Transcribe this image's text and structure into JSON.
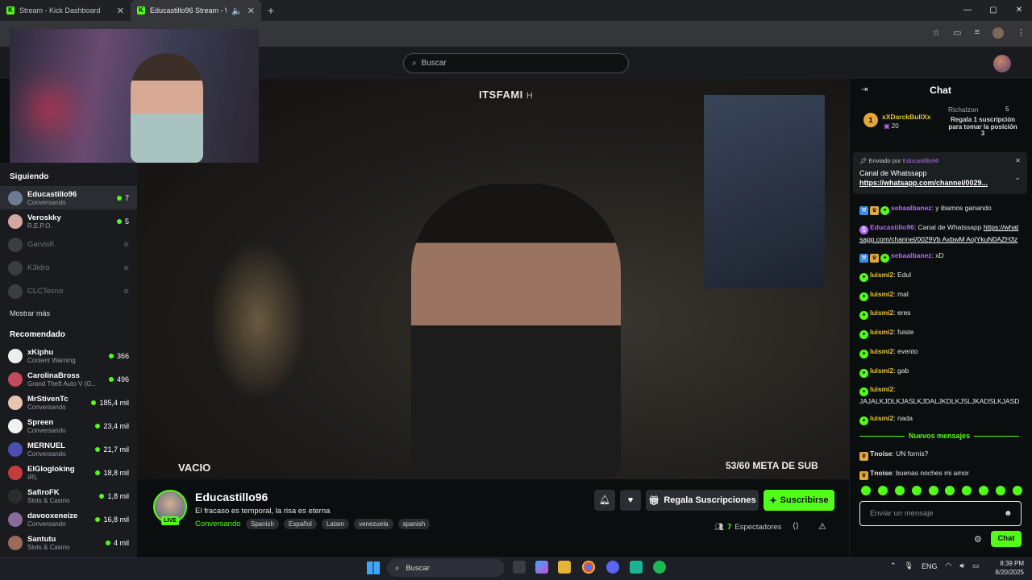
{
  "browser": {
    "tabs": [
      {
        "title": "Stream - Kick Dashboard"
      },
      {
        "title": "Educastillo96 Stream - Wat"
      }
    ],
    "new_tab": "+",
    "controls": {
      "minimize": "—",
      "maximize": "▢",
      "close": "✕"
    }
  },
  "header": {
    "search_placeholder": "Buscar"
  },
  "sidebar": {
    "following_title": "Siguiendo",
    "following": [
      {
        "name": "Educastillo96",
        "category": "Conversando",
        "viewers": "7",
        "avatar_color": "#6d7b95",
        "live": true
      },
      {
        "name": "Veroskky",
        "category": "R.E.P.O.",
        "viewers": "5",
        "avatar_color": "#d4a7a0",
        "live": true
      },
      {
        "name": "GarvisK",
        "category": "",
        "viewers": "",
        "live": false
      },
      {
        "name": "K3idro",
        "category": "",
        "viewers": "",
        "live": false
      },
      {
        "name": "CLCTecno",
        "category": "",
        "viewers": "",
        "live": false
      }
    ],
    "show_more": "Mostrar más",
    "recommended_title": "Recomendado",
    "recommended": [
      {
        "name": "xKiphu",
        "category": "Content Warning",
        "viewers": "366",
        "avatar_color": "#eeeeee"
      },
      {
        "name": "CarolinaBross",
        "category": "Grand Theft Auto V (G...",
        "viewers": "496",
        "avatar_color": "#c24a5a"
      },
      {
        "name": "MrStivenTc",
        "category": "Conversando",
        "viewers": "185,4 mil",
        "avatar_color": "#e8c4b0"
      },
      {
        "name": "Spreen",
        "category": "Conversando",
        "viewers": "23,4 mil",
        "avatar_color": "#f2f2f2"
      },
      {
        "name": "MERNUEL",
        "category": "Conversando",
        "viewers": "21,7 mil",
        "avatar_color": "#4b4fb0"
      },
      {
        "name": "ElGlogloking",
        "category": "IRL",
        "viewers": "18,8 mil",
        "avatar_color": "#c43c3c"
      },
      {
        "name": "SafiroFK",
        "category": "Slots & Casino",
        "viewers": "1,8 mil",
        "avatar_color": "#2c2c2c"
      },
      {
        "name": "davooxeneize",
        "category": "Conversando",
        "viewers": "16,8 mil",
        "avatar_color": "#8a6a9a"
      },
      {
        "name": "Santutu",
        "category": "Slots & Casino",
        "viewers": "4 mil",
        "avatar_color": "#9a6a5a"
      }
    ]
  },
  "video": {
    "overlay_title": "ITSFAMI",
    "overlay_title_suffix": "H",
    "overlay_left": "VACIO",
    "overlay_right": "53/60 META DE SUB"
  },
  "stream": {
    "channel": "Educastillo96",
    "live_badge": "LIVE",
    "title": "El fracaso es temporal, la risa es eterna",
    "category": "Conversando",
    "tags": [
      "Spanish",
      "Español",
      "Latam",
      "venezuela",
      "spanish"
    ],
    "gift_label": "Regala Suscripciones",
    "subscribe_label": "Suscribirse",
    "viewers_count": "7",
    "viewers_label": "Espectadores"
  },
  "chat": {
    "title": "Chat",
    "leaderboard": {
      "first": {
        "rank": "1",
        "name": "xXDarckBullXx",
        "count": "20"
      },
      "second": {
        "name": "Richalzon",
        "count": "5",
        "hint": "Regala 1 suscripción para tomar la posición 3"
      }
    },
    "pinned": {
      "by_prefix": "Enviado por",
      "by_user": "Educastillo96",
      "title": "Canal de Whatssapp",
      "link": "https://whatsapp.com/channel/0029..."
    },
    "messages": [
      {
        "user": "sebaalbanez",
        "color": "#b26bf5",
        "badges": [
          "mod",
          "crown",
          "sub"
        ],
        "text": ": y ibamos ganando"
      },
      {
        "user": "Educastillo96",
        "color": "#b26bf5",
        "badges": [
          "mic"
        ],
        "text": ": Canal de Whatssapp ",
        "link": "https://whatsapp.com/channel/0029Vb AxbwM AojYkuN0AZH3z"
      },
      {
        "user": "sebaalbanez",
        "color": "#b26bf5",
        "badges": [
          "mod",
          "crown",
          "sub"
        ],
        "text": ": xD"
      },
      {
        "user": "luismi2",
        "color": "#e6c23a",
        "badges": [
          "sub"
        ],
        "text": ": Edul"
      },
      {
        "user": "luismi2",
        "color": "#e6c23a",
        "badges": [
          "sub"
        ],
        "text": ": mal"
      },
      {
        "user": "luismi2",
        "color": "#e6c23a",
        "badges": [
          "sub"
        ],
        "text": ": eres"
      },
      {
        "user": "luismi2",
        "color": "#e6c23a",
        "badges": [
          "sub"
        ],
        "text": ": fuiste"
      },
      {
        "user": "luismi2",
        "color": "#e6c23a",
        "badges": [
          "sub"
        ],
        "text": ": evento"
      },
      {
        "user": "luismi2",
        "color": "#e6c23a",
        "badges": [
          "sub"
        ],
        "text": ": gab"
      },
      {
        "user": "luismi2",
        "color": "#e6c23a",
        "badges": [
          "sub"
        ],
        "text": ": JAJALKJDLKJASLKJDALJKDLKJSLJKADSLKJASD"
      },
      {
        "user": "luismi2",
        "color": "#e6c23a",
        "badges": [
          "sub"
        ],
        "text": ": nada"
      }
    ],
    "new_messages_label": "Nuevos mensajes",
    "recent": [
      {
        "user": "Tnoise",
        "color": "#e6e6e6",
        "badges": [
          "crown"
        ],
        "text": ": UN fornis?"
      },
      {
        "user": "Tnoise",
        "color": "#e6e6e6",
        "badges": [
          "crown"
        ],
        "text": ": buenas noches mi amor"
      }
    ],
    "input_placeholder": "Enviar un mensaje",
    "send_label": "Chat"
  },
  "taskbar": {
    "search_placeholder": "Buscar",
    "language": "ENG",
    "time": "8:39 PM",
    "date": "8/20/2025"
  },
  "colors": {
    "accent": "#53fc18",
    "background": "#0b0e0f",
    "panel": "#191b1f"
  }
}
